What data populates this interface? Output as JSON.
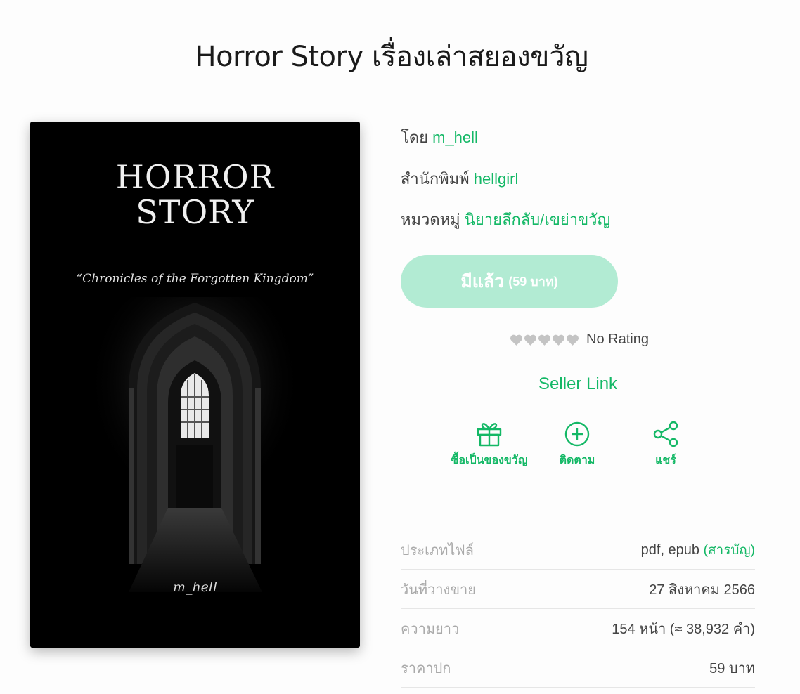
{
  "page": {
    "title": "Horror Story เรื่องเล่าสยองขวัญ"
  },
  "cover": {
    "title_line1": "HORROR",
    "title_line2": "STORY",
    "subtitle": "“Chronicles of the Forgotten Kingdom”",
    "author": "m_hell"
  },
  "meta": {
    "author_label": "โดย",
    "author_value": "m_hell",
    "publisher_label": "สำนักพิมพ์",
    "publisher_value": "hellgirl",
    "category_label": "หมวดหมู่",
    "category_value": "นิยายลึกลับ/เขย่าขวัญ"
  },
  "owned_button": {
    "label": "มีแล้ว",
    "price": "(59 บาท)"
  },
  "rating": {
    "text": "No Rating",
    "hearts_total": 5,
    "hearts_filled": 0
  },
  "seller_link": "Seller Link",
  "actions": {
    "gift": "ซื้อเป็นของขวัญ",
    "follow": "ติดตาม",
    "share": "แชร์"
  },
  "info": [
    {
      "key": "ประเภทไฟล์",
      "value": "pdf, epub",
      "link": "(สารบัญ)"
    },
    {
      "key": "วันที่วางขาย",
      "value": "27 สิงหาคม 2566"
    },
    {
      "key": "ความยาว",
      "value": "154 หน้า (≈ 38,932 คำ)"
    },
    {
      "key": "ราคาปก",
      "value": "59 บาท"
    }
  ],
  "colors": {
    "accent": "#14b866",
    "owned_button_bg": "#b2ebd3",
    "heart": "#c4c4c4"
  },
  "icons": {
    "gift": "gift-icon",
    "follow": "plus-circle-icon",
    "share": "share-icon",
    "rating": "heart-icon"
  }
}
